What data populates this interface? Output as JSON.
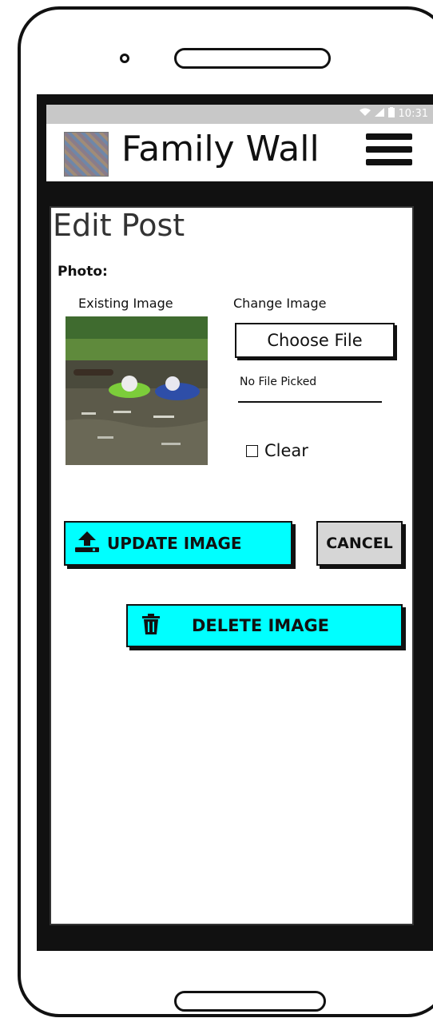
{
  "app": {
    "title": "Family Wall",
    "status_time": "10:31"
  },
  "page": {
    "title": "Edit Post",
    "photo_label": "Photo:",
    "existing_label": "Existing Image",
    "change_label": "Change Image",
    "choose_file_label": "Choose File",
    "no_file_text": "No File Picked",
    "clear_label": "Clear",
    "clear_checked": false
  },
  "buttons": {
    "update": "UPDATE IMAGE",
    "cancel": "CANCEL",
    "delete": "DELETE IMAGE"
  },
  "icons": {
    "menu": "hamburger-menu-icon",
    "upload": "upload-icon",
    "trash": "trash-icon",
    "wifi": "wifi-icon",
    "signal": "signal-icon",
    "battery": "battery-icon"
  },
  "colors": {
    "accent": "#00ffff",
    "cancel_bg": "#d6d6d6",
    "statusbar": "#c8c8c8"
  }
}
